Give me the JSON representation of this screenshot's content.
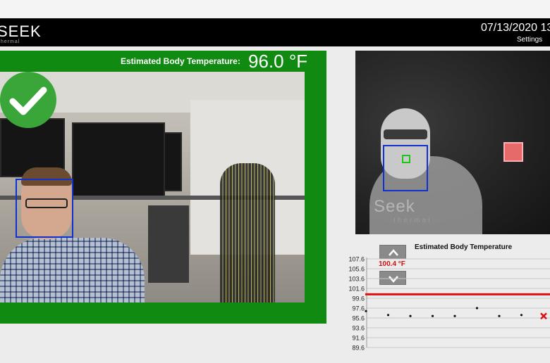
{
  "header": {
    "logo_text": "SEEK",
    "logo_sub": "thermal",
    "datetime": "07/13/2020 13",
    "settings_label": "Settings"
  },
  "detection": {
    "label": "Estimated Body Temperature:",
    "value": "96.0 °F",
    "status": "pass",
    "status_icon": "checkmark-icon",
    "status_color": "#3aa63a",
    "panel_color": "#118a11",
    "face_box_color": "#1030d0"
  },
  "thermal": {
    "logo_text": "Seek",
    "logo_sub": "thermal",
    "hotspot_color": "#e76a6a"
  },
  "chart": {
    "title": "Estimated Body Temperature",
    "threshold_label": "100.4 °F",
    "threshold_color": "#e01010",
    "up_icon": "chevron-up-icon",
    "down_icon": "chevron-down-icon"
  },
  "chart_data": {
    "type": "scatter",
    "title": "Estimated Body Temperature",
    "xlabel": "",
    "ylabel": "",
    "y_ticks": [
      "107.6",
      "105.6",
      "103.6",
      "101.6",
      "99.6",
      "97.6",
      "95.6",
      "93.6",
      "91.6",
      "89.6"
    ],
    "ylim": [
      89.6,
      107.6
    ],
    "grid": true,
    "threshold": 100.4,
    "threshold_label": "100.4 °F",
    "points": [
      {
        "x": 1,
        "y": 97.0,
        "marker": "dot"
      },
      {
        "x": 2,
        "y": 96.2,
        "marker": "dot"
      },
      {
        "x": 3,
        "y": 96.0,
        "marker": "dot"
      },
      {
        "x": 4,
        "y": 96.0,
        "marker": "dot"
      },
      {
        "x": 5,
        "y": 96.0,
        "marker": "dot"
      },
      {
        "x": 6,
        "y": 97.6,
        "marker": "dot"
      },
      {
        "x": 7,
        "y": 96.0,
        "marker": "dot"
      },
      {
        "x": 8,
        "y": 96.2,
        "marker": "dot"
      },
      {
        "x": 9,
        "y": 96.0,
        "marker": "x"
      }
    ]
  }
}
